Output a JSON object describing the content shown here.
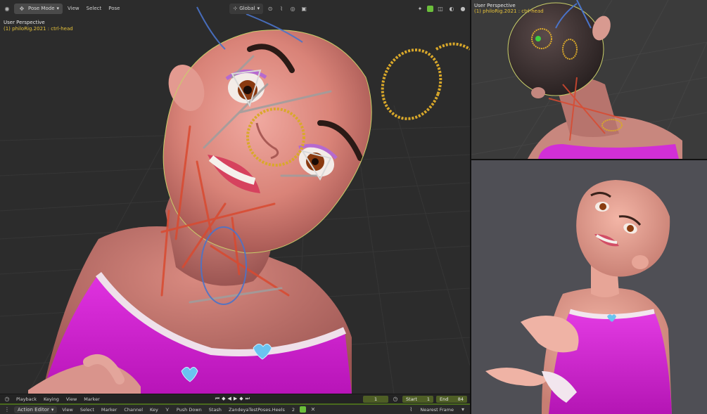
{
  "main_header": {
    "mode": "Pose Mode",
    "menus": [
      "View",
      "Select",
      "Pose"
    ],
    "orientation": "Global",
    "pose_options": "Pose Options",
    "close_mark": "X"
  },
  "main_viewport": {
    "title": "User Perspective",
    "subtitle": "(1) philoRig.2021 : ctrl-head"
  },
  "topright_viewport": {
    "title": "User Perspective",
    "subtitle": "(1) philoRig.2021 : ctrl-head"
  },
  "timeline": {
    "menus": [
      "Playback",
      "Keying",
      "View",
      "Marker"
    ],
    "current_frame": "1",
    "start_label": "Start",
    "start_value": "1",
    "end_label": "End",
    "end_value": "84"
  },
  "action_editor": {
    "editor": "Action Editor",
    "menus": [
      "View",
      "Select",
      "Marker",
      "Channel",
      "Key"
    ],
    "push_down": "Push Down",
    "stash": "Stash",
    "action_name": "ZandeyaTestPoses.Heels",
    "users": "2",
    "snap": "Nearest Frame"
  },
  "colors": {
    "accent_green": "#5a6e2f",
    "overlay_yellow": "#e6c23a",
    "dress_magenta": "#d21fd6"
  },
  "icons": [
    "cursor-icon",
    "select-box-icon",
    "pivot-icon",
    "snap-icon",
    "proportional-icon",
    "viewport-shading-icon",
    "play-icon",
    "rewind-icon",
    "clock-icon",
    "keyframe-icon",
    "pin-icon"
  ]
}
